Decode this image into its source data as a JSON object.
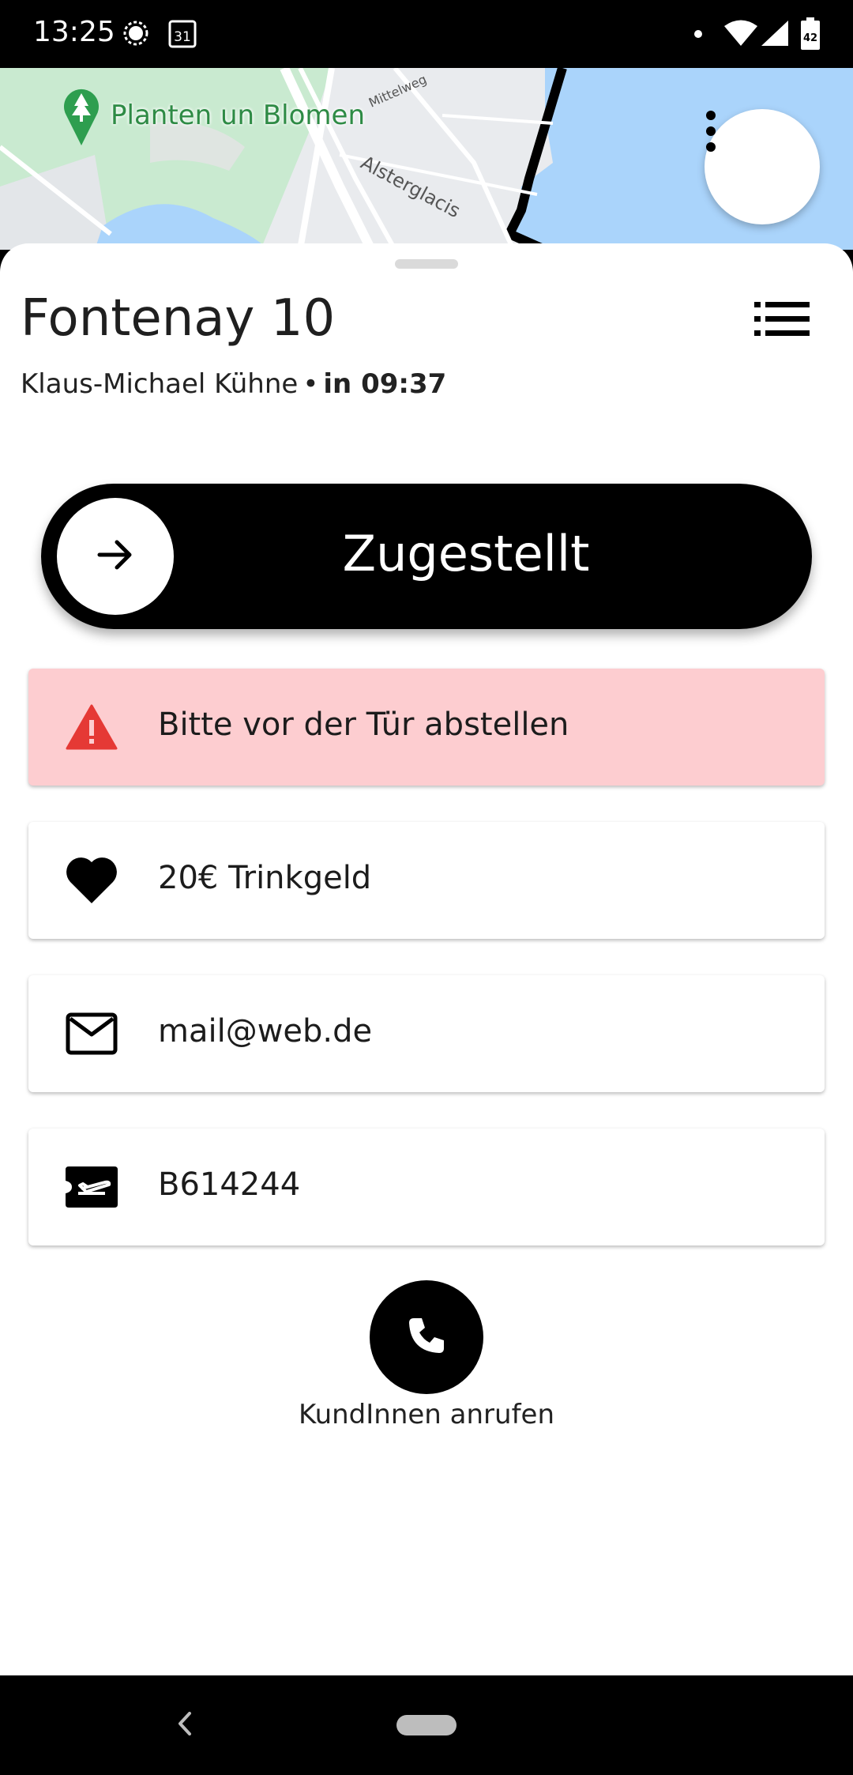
{
  "status_bar": {
    "time": "13:25",
    "calendar_day": "31",
    "battery_level": "42",
    "icons": [
      "signal-messenger-icon",
      "calendar-icon",
      "notification-dot-icon",
      "wifi-icon",
      "cellular-signal-icon",
      "battery-icon"
    ]
  },
  "map": {
    "place_label": "Planten un Blomen",
    "street_labels": [
      "Alsterglacis",
      "Mittelweg"
    ],
    "colors": {
      "water": "#aad4fb",
      "park": "#c9ead0",
      "land": "#e9ebee",
      "route": "#000000"
    }
  },
  "stop": {
    "title": "Fontenay 10",
    "customer_name": "Klaus-Michael Kühne",
    "separator": "•",
    "eta": "in 09:37"
  },
  "slide_action": {
    "label": "Zugestellt",
    "knob_icon": "arrow-right-icon"
  },
  "cards": [
    {
      "icon": "warning-icon",
      "text": "Bitte vor der Tür abstellen",
      "background": "#fdcdd0",
      "icon_color": "#e53935"
    },
    {
      "icon": "heart-icon",
      "text": "20€ Trinkgeld"
    },
    {
      "icon": "mail-icon",
      "text": "mail@web.de"
    },
    {
      "icon": "ticket-flight-icon",
      "text": "B614244"
    }
  ],
  "call": {
    "icon": "phone-icon",
    "label": "KundInnen anrufen"
  }
}
